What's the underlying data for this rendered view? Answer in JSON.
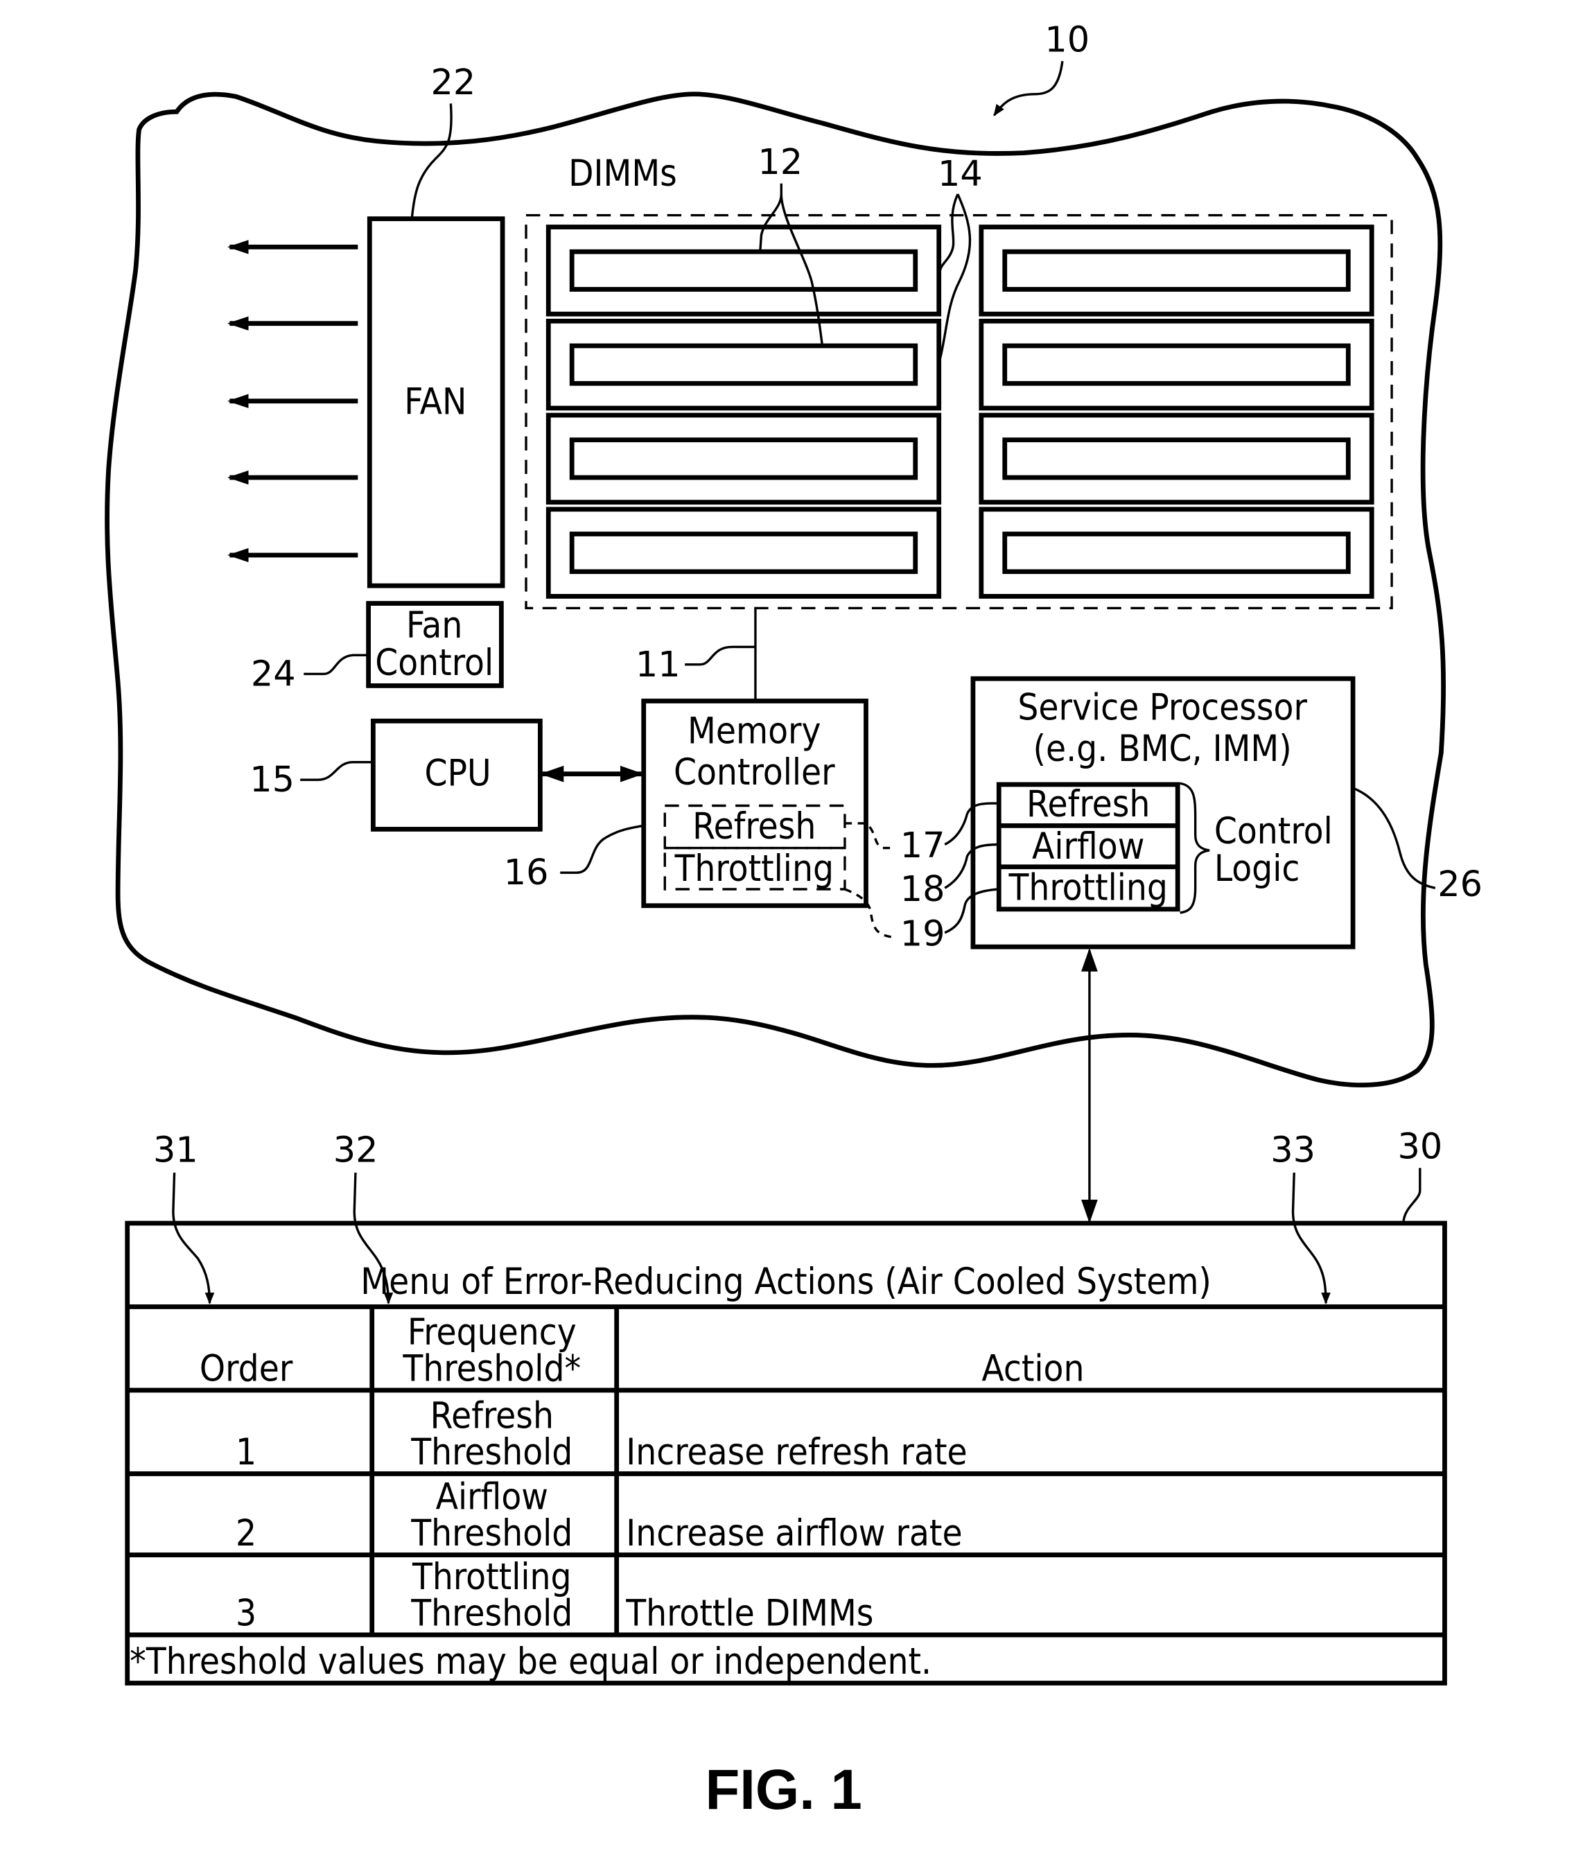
{
  "figure": {
    "caption": "FIG. 1",
    "system_ref": "10"
  },
  "components": {
    "fan": {
      "label": "FAN",
      "ref": "22"
    },
    "fan_control": {
      "label_line1": "Fan",
      "label_line2": "Control",
      "ref": "24"
    },
    "dimms": {
      "label": "DIMMs",
      "ref_dimm": "12",
      "ref_slot": "14",
      "count": 8
    },
    "bus": {
      "ref": "11"
    },
    "cpu": {
      "label": "CPU",
      "ref": "15"
    },
    "memory_controller": {
      "label_line1": "Memory",
      "label_line2": "Controller",
      "ref": "16",
      "sub_refresh": "Refresh",
      "sub_throttling": "Throttling"
    },
    "service_processor": {
      "label_line1": "Service Processor",
      "label_line2": "(e.g. BMC, IMM)",
      "ref": "26",
      "logic": [
        "Refresh",
        "Airflow",
        "Throttling"
      ],
      "control_logic_line1": "Control",
      "control_logic_line2": "Logic"
    },
    "logic_refs": [
      "17",
      "18",
      "19"
    ]
  },
  "menu_table": {
    "ref": "30",
    "col_refs": [
      "31",
      "32",
      "33"
    ],
    "title": "Menu of Error-Reducing Actions (Air Cooled System)",
    "headers": {
      "order": "Order",
      "threshold_line1": "Frequency",
      "threshold_line2": "Threshold*",
      "action": "Action"
    },
    "rows": [
      {
        "order": "1",
        "threshold_line1": "Refresh",
        "threshold_line2": "Threshold",
        "action": "Increase refresh rate"
      },
      {
        "order": "2",
        "threshold_line1": "Airflow",
        "threshold_line2": "Threshold",
        "action": "Increase airflow rate"
      },
      {
        "order": "3",
        "threshold_line1": "Throttling",
        "threshold_line2": "Threshold",
        "action": "Throttle DIMMs"
      }
    ],
    "footnote": "*Threshold values may be equal or independent."
  }
}
